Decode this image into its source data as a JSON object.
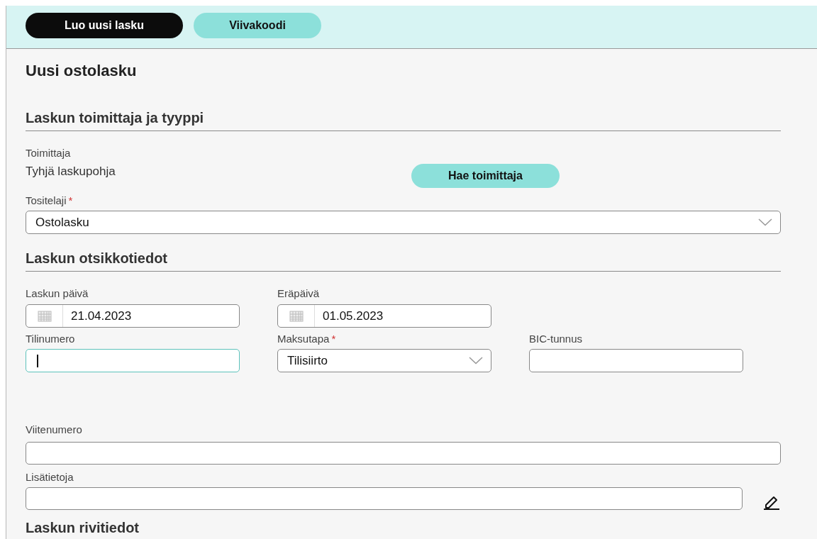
{
  "toolbar": {
    "buttons": [
      {
        "label": "Luo uusi lasku",
        "kind": "primary"
      },
      {
        "label": "Viivakoodi",
        "kind": "secondary"
      }
    ]
  },
  "title": "Uusi ostolasku",
  "supplier_section": {
    "heading": "Laskun toimittaja ja tyyppi",
    "supplier_label": "Toimittaja",
    "supplier_value": "Tyhjä laskupohja",
    "search_button": "Hae toimittaja",
    "document_type": {
      "kind": "select",
      "label": "Tositelaji",
      "required_mark": "*",
      "value": "Ostolasku",
      "focused": false
    }
  },
  "header_section": {
    "heading": "Laskun otsikkotiedot",
    "rows": [
      [
        {
          "kind": "date",
          "label": "Laskun päivä",
          "value": "21.04.2023",
          "focused": false
        },
        {
          "kind": "date",
          "label": "Eräpäivä",
          "value": "01.05.2023",
          "focused": false
        }
      ],
      [
        {
          "kind": "text",
          "label": "Tilinumero",
          "focused": true
        },
        {
          "kind": "select",
          "label": "Maksutapa",
          "required_mark": "*",
          "value": "Tilisiirto",
          "focused": false
        },
        {
          "kind": "text",
          "label": "BIC-tunnus",
          "focused": false
        }
      ]
    ],
    "reference": {
      "kind": "text",
      "label": "Viitenumero",
      "focused": false
    },
    "notes": {
      "kind": "text",
      "label": "Lisätietoja",
      "focused": false
    }
  },
  "next_section_heading": "Laskun rivitiedot"
}
